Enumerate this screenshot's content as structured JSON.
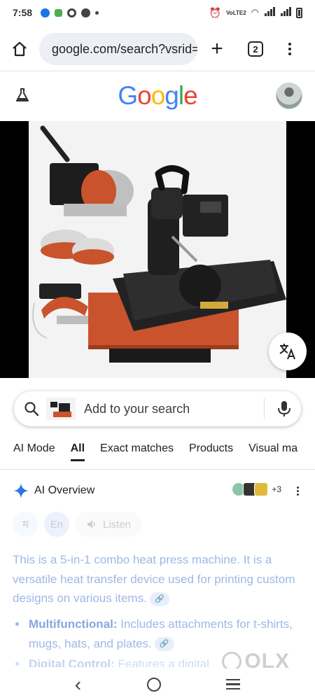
{
  "status_bar": {
    "time": "7:58",
    "network_label": "VoLTE2"
  },
  "browser": {
    "url": "google.com/search?vsrid=",
    "tab_count": "2"
  },
  "header": {
    "logo_letters": [
      {
        "char": "G",
        "color": "#4285F4"
      },
      {
        "char": "o",
        "color": "#EA4335"
      },
      {
        "char": "o",
        "color": "#FBBC05"
      },
      {
        "char": "g",
        "color": "#4285F4"
      },
      {
        "char": "l",
        "color": "#34A853"
      },
      {
        "char": "e",
        "color": "#EA4335"
      }
    ]
  },
  "search": {
    "placeholder": "Add to your search"
  },
  "filter_tabs": [
    {
      "label": "AI Mode",
      "active": false
    },
    {
      "label": "All",
      "active": true
    },
    {
      "label": "Exact matches",
      "active": false
    },
    {
      "label": "Products",
      "active": false
    },
    {
      "label": "Visual ma",
      "active": false
    }
  ],
  "ai_overview": {
    "title": "AI Overview",
    "source_count": "+3",
    "languages": [
      "म",
      "En"
    ],
    "listen_label": "Listen",
    "summary": "This is a 5-in-1 combo heat press machine. It is a versatile heat transfer device used for printing custom designs on various items.",
    "bullets": [
      {
        "title": "Multifunctional:",
        "text": " Includes attachments for t-shirts, mugs, hats, and plates."
      },
      {
        "title": "Digital Control:",
        "text": " Features a digital"
      }
    ]
  },
  "watermark": {
    "text": "OLX"
  },
  "colors": {
    "accent": "#4285F4",
    "ai_text": "#9fb8e6"
  }
}
